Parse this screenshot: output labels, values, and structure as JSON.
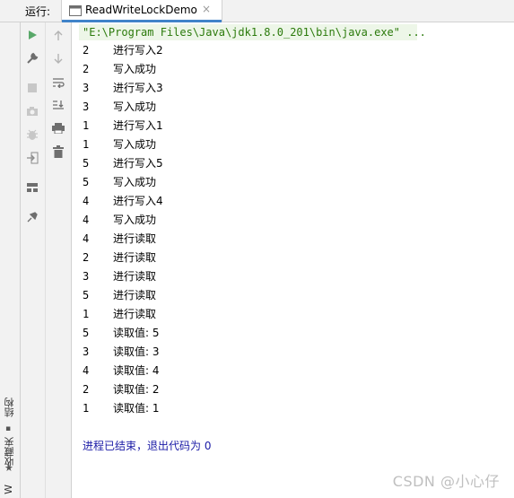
{
  "run_bar": {
    "label": "运行:",
    "tab_title": "ReadWriteLockDemo",
    "tab_close": "×"
  },
  "left_stripe": {
    "structure_label": "结构",
    "favorites_label": "收藏夹",
    "web_label": "W"
  },
  "toolbar": {
    "run_icon": "play-icon",
    "wrench_icon": "wrench-icon",
    "stop_icon": "stop-icon",
    "camera_icon": "camera-icon",
    "bug_icon": "bug-icon",
    "login_icon": "login-icon",
    "layout_icon": "layout-icon",
    "pin_icon": "pin-icon",
    "up_icon": "arrow-up-icon",
    "down_icon": "arrow-down-icon",
    "wrap_icon": "soft-wrap-icon",
    "scroll_end_icon": "scroll-to-end-icon",
    "print_icon": "print-icon",
    "trash_icon": "trash-icon"
  },
  "console": {
    "command": "\"E:\\Program Files\\Java\\jdk1.8.0_201\\bin\\java.exe\" ...",
    "lines": [
      {
        "tid": "2",
        "msg": "进行写入2"
      },
      {
        "tid": "2",
        "msg": "写入成功"
      },
      {
        "tid": "3",
        "msg": "进行写入3"
      },
      {
        "tid": "3",
        "msg": "写入成功"
      },
      {
        "tid": "1",
        "msg": "进行写入1"
      },
      {
        "tid": "1",
        "msg": "写入成功"
      },
      {
        "tid": "5",
        "msg": "进行写入5"
      },
      {
        "tid": "5",
        "msg": "写入成功"
      },
      {
        "tid": "4",
        "msg": "进行写入4"
      },
      {
        "tid": "4",
        "msg": "写入成功"
      },
      {
        "tid": "4",
        "msg": "进行读取"
      },
      {
        "tid": "2",
        "msg": "进行读取"
      },
      {
        "tid": "3",
        "msg": "进行读取"
      },
      {
        "tid": "5",
        "msg": "进行读取"
      },
      {
        "tid": "1",
        "msg": "进行读取"
      },
      {
        "tid": "5",
        "msg": "读取值: 5"
      },
      {
        "tid": "3",
        "msg": "读取值: 3"
      },
      {
        "tid": "4",
        "msg": "读取值: 4"
      },
      {
        "tid": "2",
        "msg": "读取值: 2"
      },
      {
        "tid": "1",
        "msg": "读取值: 1"
      }
    ],
    "exit_message": "进程已结束，退出代码为 0"
  },
  "watermark": "CSDN @小心仔",
  "colors": {
    "command_text": "#2b7a0b",
    "command_bg": "#edf6e8",
    "exit_text": "#1a1aa6",
    "run_green": "#59a869",
    "tab_underline": "#4083c9"
  }
}
